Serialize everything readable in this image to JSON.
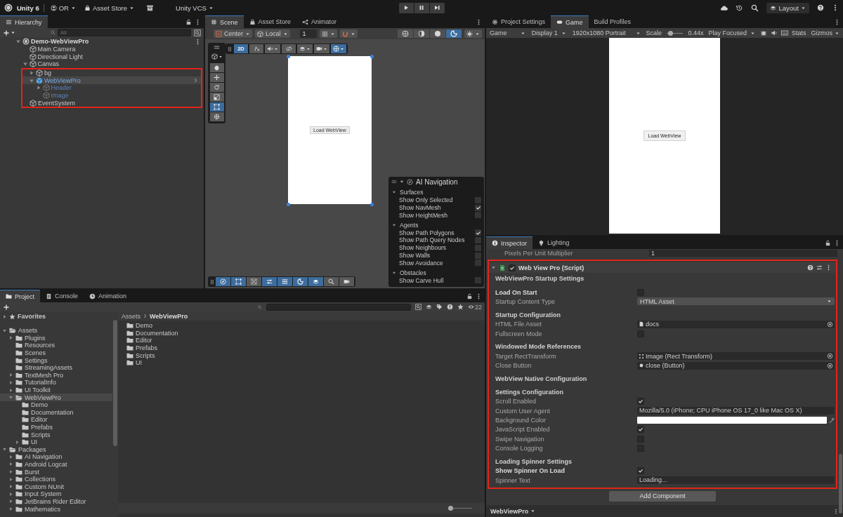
{
  "menubar": {
    "title": "Unity 6",
    "items": [
      {
        "kind": "account",
        "label": "OR"
      },
      {
        "kind": "store",
        "label": "Asset Store"
      },
      {
        "kind": "vcs",
        "label": "Unity VCS"
      }
    ],
    "layout": "Layout"
  },
  "hierarchy": {
    "tabs": [
      {
        "label": "Hierarchy",
        "selected": true
      }
    ],
    "search_placeholder": "All",
    "items": [
      {
        "label": "Demo-WebViewPro",
        "kind": "scene",
        "expandable": true,
        "expanded": true,
        "selected": false,
        "prefab": false,
        "active": true,
        "highlighted": false,
        "children": [
          {
            "label": "Main Camera",
            "kind": "object",
            "expandable": false,
            "selected": false,
            "prefab": false,
            "active": true,
            "highlighted": false
          },
          {
            "label": "Directional Light",
            "kind": "object",
            "expandable": false,
            "selected": false,
            "prefab": false,
            "active": true,
            "highlighted": false
          },
          {
            "label": "Canvas",
            "kind": "object",
            "expandable": true,
            "expanded": true,
            "selected": false,
            "prefab": false,
            "active": true,
            "highlighted": false,
            "children": [
              {
                "label": "bg",
                "kind": "object",
                "expandable": true,
                "expanded": false,
                "selected": false,
                "prefab": false,
                "active": true,
                "highlighted": true
              },
              {
                "label": "WebViewPro",
                "kind": "prefab",
                "expandable": true,
                "expanded": true,
                "selected": true,
                "prefab": true,
                "active": true,
                "highlighted": true,
                "children": [
                  {
                    "label": "Header",
                    "kind": "object",
                    "expandable": true,
                    "expanded": false,
                    "selected": false,
                    "prefab": true,
                    "active": false,
                    "highlighted": true
                  },
                  {
                    "label": "Image",
                    "kind": "object",
                    "expandable": false,
                    "selected": false,
                    "prefab": true,
                    "active": false,
                    "highlighted": true
                  }
                ]
              }
            ]
          },
          {
            "label": "EventSystem",
            "kind": "object",
            "expandable": false,
            "selected": false,
            "prefab": false,
            "active": true,
            "highlighted": true
          }
        ]
      }
    ]
  },
  "scene": {
    "tabs": [
      {
        "label": "Scene",
        "selected": true
      },
      {
        "label": "Asset Store",
        "selected": false
      },
      {
        "label": "Animator",
        "selected": false
      }
    ],
    "pivot": "Center",
    "space": "Local",
    "grid_snap": "1",
    "shading": [
      {
        "selected": false
      },
      {
        "selected": false
      },
      {
        "selected": false
      },
      {
        "selected": true
      }
    ],
    "tools": [
      {
        "selected": false
      },
      {
        "selected": false
      },
      {
        "selected": false
      },
      {
        "selected": false
      },
      {
        "selected": true
      },
      {
        "selected": false
      }
    ],
    "view_options": [
      {
        "label": "2D",
        "selected": true
      },
      {
        "selected": false
      },
      {
        "selected": false
      },
      {
        "selected": false
      },
      {
        "selected": false
      },
      {
        "selected": false
      },
      {
        "selected": true
      }
    ],
    "canvas_button": "Load WebView",
    "ai_navigation": {
      "title": "AI Navigation",
      "sections": [
        {
          "title": "Surfaces",
          "expanded": true,
          "items": [
            {
              "label": "Show Only Selected",
              "checked": false
            },
            {
              "label": "Show NavMesh",
              "checked": true
            },
            {
              "label": "Show HeightMesh",
              "checked": false
            }
          ]
        },
        {
          "title": "Agents",
          "expanded": true,
          "items": [
            {
              "label": "Show Path Polygons",
              "checked": true
            },
            {
              "label": "Show Path Query Nodes",
              "checked": false
            },
            {
              "label": "Show Neighbours",
              "checked": false
            },
            {
              "label": "Show Walls",
              "checked": false
            },
            {
              "label": "Show Avoidance",
              "checked": false
            }
          ]
        },
        {
          "title": "Obstacles",
          "expanded": true,
          "items": [
            {
              "label": "Show Carve Hull",
              "checked": false
            }
          ]
        }
      ]
    },
    "overlay_tools": [
      {
        "on": true
      },
      {
        "on": true
      },
      {
        "on": false
      },
      {
        "on": true
      },
      {
        "on": true
      },
      {
        "on": true
      },
      {
        "on": true
      },
      {
        "on": false
      },
      {
        "on": false
      }
    ]
  },
  "game": {
    "tabs": [
      {
        "label": "Project Settings",
        "selected": false
      },
      {
        "label": "Game",
        "selected": true
      },
      {
        "label": "Build Profiles",
        "selected": false
      }
    ],
    "view": "Game",
    "display": "Display 1",
    "resolution": "1920x1080 Portrait",
    "scale_label": "Scale",
    "scale": {
      "level": 0.08
    },
    "scale_value": "0.44x",
    "play_mode": "Play Focused",
    "stats": "Stats",
    "gizmos": "Gizmos",
    "button": "Load WebView"
  },
  "inspector": {
    "tabs": [
      {
        "label": "Inspector",
        "selected": true
      },
      {
        "label": "Lighting",
        "selected": false
      }
    ],
    "prior_field": {
      "label": "Pixels Per Unit Multiplier",
      "value": "1"
    },
    "component": {
      "title": "Web View Pro (Script)",
      "enabled": true,
      "expanded": true,
      "highlighted": true,
      "rows": [
        {
          "kind": "header",
          "label": "WebViewPro Startup Settings"
        },
        {
          "kind": "checkbox",
          "label": "Load On Start",
          "checked": false,
          "overridden": true
        },
        {
          "kind": "dropdown",
          "label": "Startup Content Type",
          "value": "HTML Asset",
          "overridden": false
        },
        {
          "kind": "header",
          "label": "Startup Configuration"
        },
        {
          "kind": "object",
          "label": "HTML File Asset",
          "value": {
            "kind": "asset",
            "label": "docs"
          },
          "overridden": false
        },
        {
          "kind": "checkbox",
          "label": "Fullscreen Mode",
          "checked": false,
          "overridden": false
        },
        {
          "kind": "header",
          "label": "Windowed Mode References"
        },
        {
          "kind": "object",
          "label": "Target RectTransform",
          "value": {
            "kind": "rect_transform",
            "label": "Image (Rect Transform)"
          },
          "overridden": false
        },
        {
          "kind": "object",
          "label": "Close Button",
          "value": {
            "kind": "button",
            "label": "close (Button)"
          },
          "overridden": false
        },
        {
          "kind": "header",
          "label": "WebView Native Configuration"
        },
        {
          "kind": "header",
          "label": "Settings Configuration"
        },
        {
          "kind": "checkbox",
          "label": "Scroll Enabled",
          "checked": true,
          "overridden": false
        },
        {
          "kind": "text",
          "label": "Custom User Agent",
          "value": "Mozilla/5.0 (iPhone; CPU iPhone OS 17_0 like Mac OS X)",
          "overridden": false
        },
        {
          "kind": "color",
          "label": "Background Color",
          "color": "#ffffff",
          "overridden": false
        },
        {
          "kind": "checkbox",
          "label": "JavaScript Enabled",
          "checked": true,
          "overridden": false
        },
        {
          "kind": "checkbox",
          "label": "Swipe Navigation",
          "checked": false,
          "overridden": false
        },
        {
          "kind": "checkbox",
          "label": "Console Logging",
          "checked": false,
          "overridden": false
        },
        {
          "kind": "header",
          "label": "Loading Spinner Settings"
        },
        {
          "kind": "checkbox",
          "label": "Show Spinner On Load",
          "checked": true,
          "overridden": true
        },
        {
          "kind": "text",
          "label": "Spinner Text",
          "value": "Loading...",
          "overridden": false
        }
      ]
    },
    "add_component": "Add Component",
    "footer": "WebViewPro"
  },
  "project": {
    "tabs": [
      {
        "label": "Project",
        "selected": true
      },
      {
        "label": "Console",
        "selected": false
      },
      {
        "label": "Animation",
        "selected": false
      }
    ],
    "hidden_count": "22",
    "tree": [
      {
        "label": "Favorites",
        "kind": "favorites",
        "expandable": true,
        "expanded": false,
        "selected": false
      },
      {
        "label": "Assets",
        "kind": "folder",
        "expandable": true,
        "expanded": true,
        "selected": false,
        "children": [
          {
            "label": "Plugins",
            "kind": "folder",
            "expandable": true,
            "expanded": false,
            "selected": false
          },
          {
            "label": "Resources",
            "kind": "folder",
            "expandable": false,
            "selected": false
          },
          {
            "label": "Scenes",
            "kind": "folder",
            "expandable": false,
            "selected": false
          },
          {
            "label": "Settings",
            "kind": "folder",
            "expandable": false,
            "selected": false
          },
          {
            "label": "StreamingAssets",
            "kind": "folder",
            "expandable": false,
            "selected": false
          },
          {
            "label": "TextMesh Pro",
            "kind": "folder",
            "expandable": true,
            "expanded": false,
            "selected": false
          },
          {
            "label": "TutorialInfo",
            "kind": "folder",
            "expandable": true,
            "expanded": false,
            "selected": false
          },
          {
            "label": "UI Toolkit",
            "kind": "folder",
            "expandable": true,
            "expanded": false,
            "selected": false
          },
          {
            "label": "WebViewPro",
            "kind": "folder",
            "expandable": true,
            "expanded": true,
            "selected": true,
            "children": [
              {
                "label": "Demo",
                "kind": "folder",
                "expandable": false,
                "selected": false
              },
              {
                "label": "Documentation",
                "kind": "folder",
                "expandable": false,
                "selected": false
              },
              {
                "label": "Editor",
                "kind": "folder",
                "expandable": false,
                "selected": false
              },
              {
                "label": "Prefabs",
                "kind": "folder",
                "expandable": false,
                "selected": false
              },
              {
                "label": "Scripts",
                "kind": "folder",
                "expandable": false,
                "selected": false
              },
              {
                "label": "UI",
                "kind": "folder",
                "expandable": true,
                "expanded": false,
                "selected": false
              }
            ]
          }
        ]
      },
      {
        "label": "Packages",
        "kind": "folder",
        "expandable": true,
        "expanded": true,
        "selected": false,
        "children": [
          {
            "label": "AI Navigation",
            "kind": "folder",
            "expandable": true,
            "expanded": false,
            "selected": false
          },
          {
            "label": "Android Logcat",
            "kind": "folder",
            "expandable": true,
            "expanded": false,
            "selected": false
          },
          {
            "label": "Burst",
            "kind": "folder",
            "expandable": true,
            "expanded": false,
            "selected": false
          },
          {
            "label": "Collections",
            "kind": "folder",
            "expandable": true,
            "expanded": false,
            "selected": false
          },
          {
            "label": "Custom NUnit",
            "kind": "folder",
            "expandable": true,
            "expanded": false,
            "selected": false
          },
          {
            "label": "Input System",
            "kind": "folder",
            "expandable": true,
            "expanded": false,
            "selected": false
          },
          {
            "label": "JetBrains Rider Editor",
            "kind": "folder",
            "expandable": true,
            "expanded": false,
            "selected": false
          },
          {
            "label": "Mathematics",
            "kind": "folder",
            "expandable": true,
            "expanded": false,
            "selected": false
          }
        ]
      }
    ],
    "breadcrumb": [
      {
        "label": "Assets",
        "current": false
      },
      {
        "label": "WebViewPro",
        "current": true
      }
    ],
    "contents": [
      "Demo",
      "Documentation",
      "Editor",
      "Prefabs",
      "Scripts",
      "UI"
    ],
    "icon_size": {
      "level": 0
    }
  }
}
